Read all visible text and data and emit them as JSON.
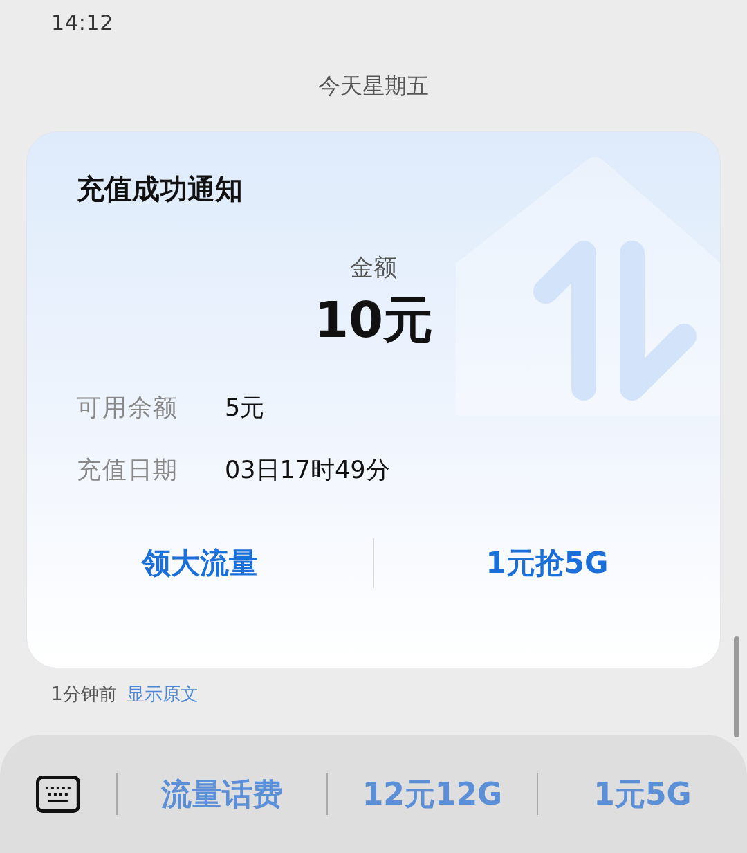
{
  "status_bar": {
    "time": "14:12"
  },
  "date_header": "今天星期五",
  "card": {
    "title": "充值成功通知",
    "amount_label": "金额",
    "amount": "10元",
    "details": [
      {
        "label": "可用余额",
        "value": "5元"
      },
      {
        "label": "充值日期",
        "value": "03日17时49分"
      }
    ],
    "actions": [
      "领大流量",
      "1元抢5G"
    ]
  },
  "meta": {
    "time": "1分钟前",
    "link": "显示原文"
  },
  "quick_replies": [
    "流量话费",
    "12元12G",
    "1元5G"
  ]
}
